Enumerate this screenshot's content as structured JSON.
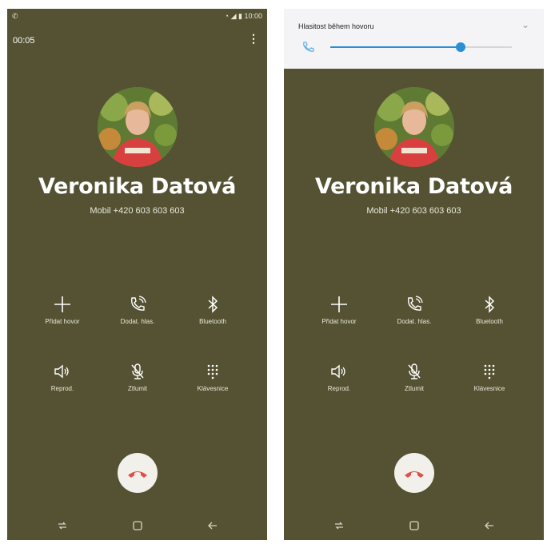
{
  "left_screen": {
    "status_time": "10:00",
    "call_timer": "00:05",
    "contact_name": "Veronika Datová",
    "contact_number": "Mobil  +420 603 603 603",
    "buttons": [
      {
        "label": "Přidat hovor"
      },
      {
        "label": "Dodat. hlas."
      },
      {
        "label": "Bluetooth"
      },
      {
        "label": "Reprod."
      },
      {
        "label": "Ztlumit"
      },
      {
        "label": "Klávesnice"
      }
    ]
  },
  "right_screen": {
    "volume_title": "Hlasitost během hovoru",
    "volume_level": 0.72,
    "contact_name": "Veronika Datová",
    "contact_number": "Mobil  +420 603 603 603",
    "buttons": [
      {
        "label": "Přidat hovor"
      },
      {
        "label": "Dodat. hlas."
      },
      {
        "label": "Bluetooth"
      },
      {
        "label": "Reprod."
      },
      {
        "label": "Ztlumit"
      },
      {
        "label": "Klávesnice"
      }
    ]
  },
  "colors": {
    "background": "#545233",
    "end_call": "#e0504a",
    "accent": "#2a8fd6"
  }
}
